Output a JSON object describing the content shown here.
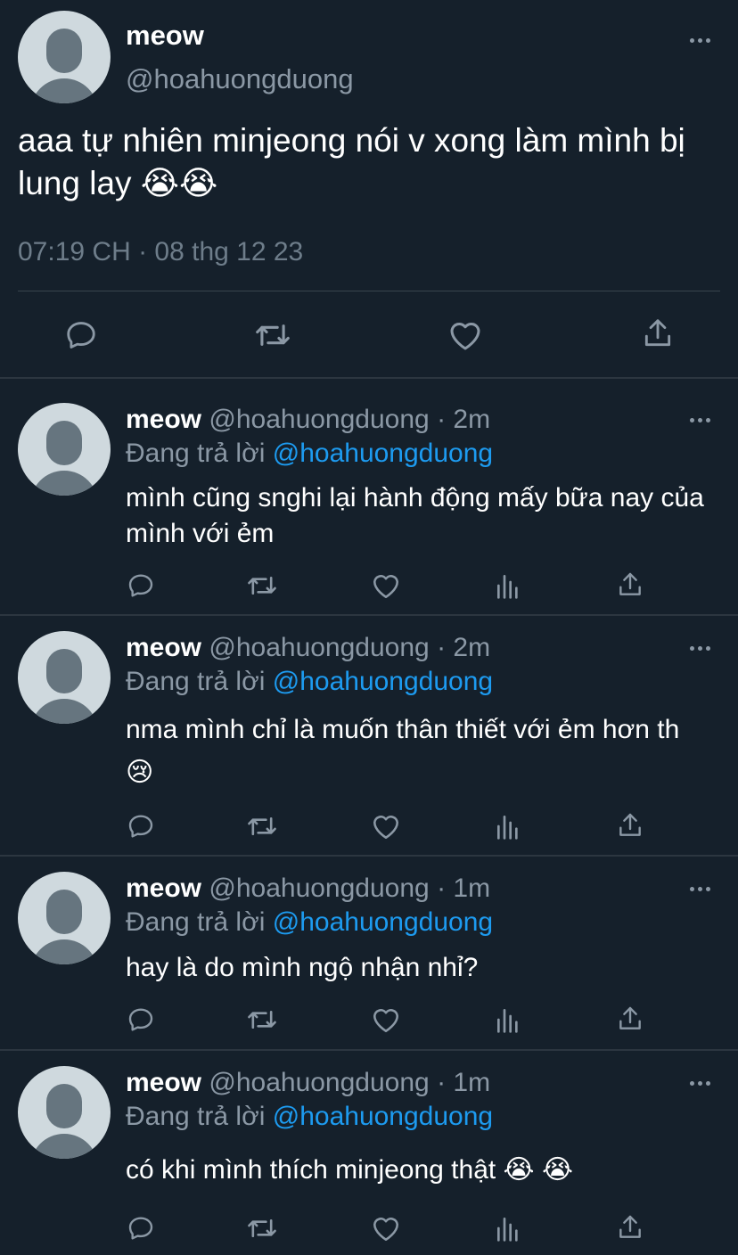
{
  "main_tweet": {
    "name": "meow",
    "handle": "@hoahuongduong",
    "text": "aaa tự nhiên minjeong nói v xong làm mình bị lung lay 😭😭",
    "meta": "07:19 CH · 08 thg 12 23"
  },
  "main_actions": [
    "reply-icon",
    "retweet-icon",
    "like-icon",
    "share-icon"
  ],
  "reply_actions": [
    "reply-icon",
    "retweet-icon",
    "like-icon",
    "views-icon",
    "share-icon"
  ],
  "replies": [
    {
      "name": "meow",
      "handle_time": "@hoahuongduong · 2m",
      "replying_label": "Đang trả lời",
      "mention": "@hoahuongduong",
      "text": "mình cũng snghi lại hành động mấy bữa nay của mình với ẻm"
    },
    {
      "name": "meow",
      "handle_time": "@hoahuongduong · 2m",
      "replying_label": "Đang trả lời",
      "mention": "@hoahuongduong",
      "text": "nma mình chỉ là muốn thân thiết với ẻm hơn th 😢"
    },
    {
      "name": "meow",
      "handle_time": "@hoahuongduong · 1m",
      "replying_label": "Đang trả lời",
      "mention": "@hoahuongduong",
      "text": "hay là do mình ngộ nhận nhỉ?"
    },
    {
      "name": "meow",
      "handle_time": "@hoahuongduong · 1m",
      "replying_label": "Đang trả lời",
      "mention": "@hoahuongduong",
      "text": "có khi mình thích minjeong thật 😭 😭"
    }
  ],
  "colors": {
    "background": "#15202b",
    "secondary_text": "#8b98a5",
    "mention": "#1d9bf0",
    "divider": "#38444d"
  }
}
